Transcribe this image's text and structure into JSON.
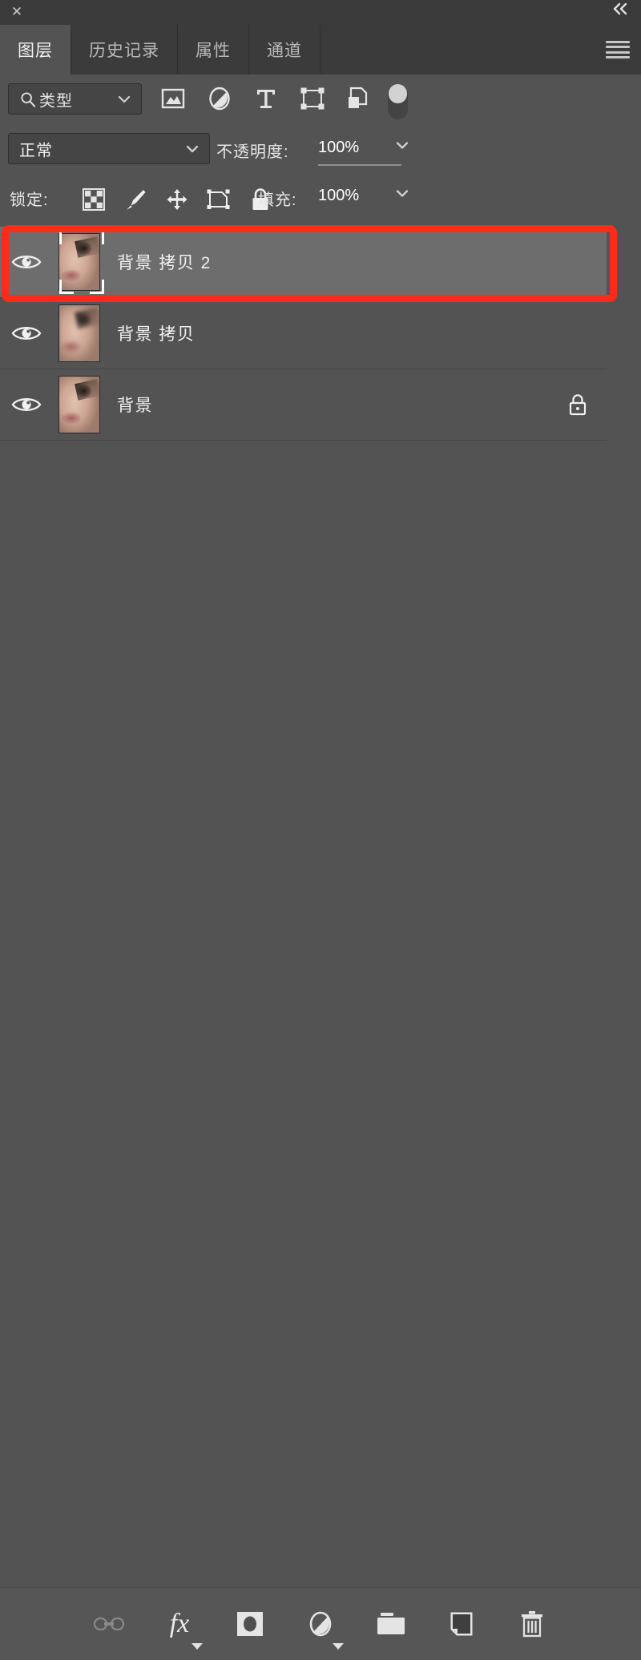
{
  "window": {
    "close_label": "✕",
    "collapse_label": "«",
    "menu_icon": "hamburger-menu-icon"
  },
  "tabs": [
    {
      "label": "图层",
      "active": true
    },
    {
      "label": "历史记录",
      "active": false
    },
    {
      "label": "属性",
      "active": false
    },
    {
      "label": "通道",
      "active": false
    }
  ],
  "filter_row": {
    "search_icon": "search-icon",
    "select_value": "类型",
    "caret": "⌄",
    "icons": [
      {
        "name": "filter-pixel-layers-icon",
        "title": "像素图层"
      },
      {
        "name": "filter-adjustment-layers-icon",
        "title": "调整图层"
      },
      {
        "name": "filter-type-layers-icon",
        "title": "文字图层"
      },
      {
        "name": "filter-shape-layers-icon",
        "title": "形状图层"
      },
      {
        "name": "filter-smart-object-icon",
        "title": "智能对象"
      }
    ],
    "toggle": {
      "name": "filter-enable-toggle",
      "state": "on"
    }
  },
  "blend_row": {
    "mode_value": "正常",
    "mode_caret": "⌄",
    "opacity_label": "不透明度:",
    "opacity_value": "100%",
    "opacity_caret": "⌄"
  },
  "lock_row": {
    "lock_label": "锁定:",
    "icons": [
      {
        "name": "lock-transparent-pixels-icon"
      },
      {
        "name": "lock-image-pixels-icon"
      },
      {
        "name": "lock-position-icon"
      },
      {
        "name": "lock-artboard-nesting-icon"
      },
      {
        "name": "lock-all-icon"
      }
    ],
    "fill_label": "填充:",
    "fill_value": "100%",
    "fill_caret": "⌄"
  },
  "layers": [
    {
      "name": "背景 拷贝 2",
      "visible": true,
      "selected": true,
      "locked": false,
      "thumbnail": "portrait-thumbnail",
      "thumbnail_selected_brackets": true,
      "thumbnail_blurred": false
    },
    {
      "name": "背景 拷贝",
      "visible": true,
      "selected": false,
      "locked": false,
      "thumbnail": "portrait-thumbnail",
      "thumbnail_selected_brackets": false,
      "thumbnail_blurred": true
    },
    {
      "name": "背景",
      "visible": true,
      "selected": false,
      "locked": true,
      "thumbnail": "portrait-thumbnail",
      "thumbnail_selected_brackets": false,
      "thumbnail_blurred": false
    }
  ],
  "bottom_toolbar": [
    {
      "name": "link-layers-button",
      "icon": "link-icon",
      "enabled": false,
      "has_caret": false
    },
    {
      "name": "layer-style-button",
      "icon": "fx-icon",
      "label": "fx",
      "enabled": true,
      "has_caret": true
    },
    {
      "name": "add-layer-mask-button",
      "icon": "mask-icon",
      "enabled": true,
      "has_caret": false
    },
    {
      "name": "new-adjustment-layer-button",
      "icon": "adjustment-icon",
      "enabled": true,
      "has_caret": true
    },
    {
      "name": "new-group-button",
      "icon": "folder-icon",
      "enabled": true,
      "has_caret": false
    },
    {
      "name": "new-layer-button",
      "icon": "new-layer-icon",
      "enabled": true,
      "has_caret": false
    },
    {
      "name": "delete-layer-button",
      "icon": "trash-icon",
      "enabled": true,
      "has_caret": false
    }
  ],
  "annotation": {
    "target_layer": "背景 拷贝 2",
    "color": "#fc2c18"
  }
}
